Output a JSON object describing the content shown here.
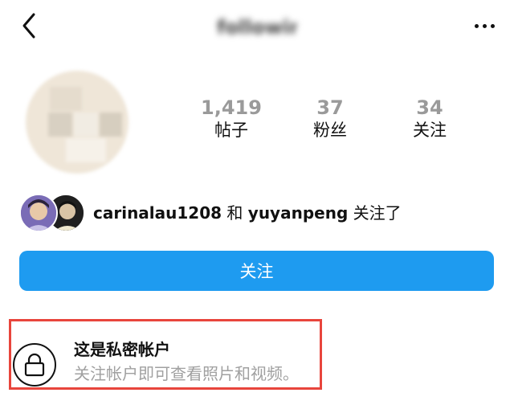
{
  "header": {
    "title": "following",
    "back_icon": "chevron-left-icon",
    "more_icon": "more-horizontal-icon"
  },
  "profile": {
    "stats": [
      {
        "value": "1,419",
        "label": "帖子"
      },
      {
        "value": "37",
        "label": "粉丝"
      },
      {
        "value": "34",
        "label": "关注"
      }
    ]
  },
  "mutual": {
    "user1": "carinalau1208",
    "connector": " 和 ",
    "user2": "yuyanpeng",
    "suffix": " 关注了"
  },
  "follow_button": {
    "label": "关注",
    "color": "#1e9bf0"
  },
  "private_notice": {
    "icon": "lock-icon",
    "title": "这是私密帐户",
    "subtitle": "关注帐户即可查看照片和视频。",
    "highlight_color": "#e8453c"
  }
}
